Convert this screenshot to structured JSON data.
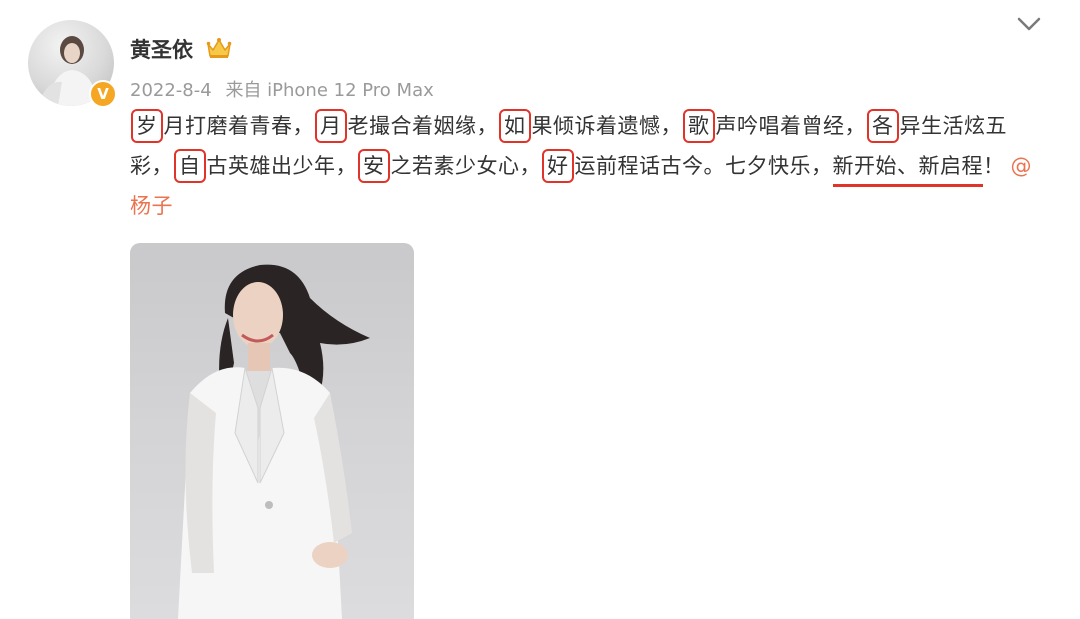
{
  "post": {
    "username": "黄圣依",
    "date": "2022-8-4",
    "source": "来自 iPhone 12 Pro Max",
    "verified_badge": "V",
    "content": {
      "s1": "岁",
      "t1": "月打磨着青春，",
      "s2": "月",
      "t2": "老撮合着姻缘，",
      "s3": "如",
      "t3": "果倾诉着遗憾，",
      "s4": "歌",
      "t4": "声吟唱着曾经，",
      "s5": "各",
      "t5": "异生活炫五彩，",
      "s6": "自",
      "t6": "古英雄出少年，",
      "s7": "安",
      "t7": "之若素少女心，",
      "s8": "好",
      "t8": "运前程话古今。七夕快乐，",
      "underlined": "新开始、新启程",
      "end": "！",
      "mention": "@杨子"
    }
  },
  "icons": {
    "crown": "crown-icon",
    "chevron": "chevron-down-icon"
  },
  "colors": {
    "highlight": "#e0342b",
    "mention": "#eb7350",
    "meta": "#9a9a9a",
    "badge": "#f5a623"
  }
}
